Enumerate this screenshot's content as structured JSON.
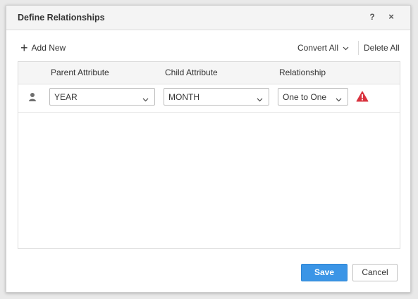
{
  "dialog": {
    "title": "Define Relationships",
    "help_glyph": "?",
    "close_glyph": "×"
  },
  "toolbar": {
    "add_new_label": "Add New",
    "convert_all_label": "Convert All",
    "delete_all_label": "Delete All"
  },
  "grid": {
    "columns": [
      "Parent Attribute",
      "Child Attribute",
      "Relationship"
    ],
    "rows": [
      {
        "icon": "user-icon",
        "parent": "YEAR",
        "child": "MONTH",
        "relationship": "One to One",
        "status_icon": "warning-icon",
        "status_color": "#d9333f"
      }
    ]
  },
  "footer": {
    "save_label": "Save",
    "cancel_label": "Cancel"
  },
  "colors": {
    "primary": "#3b95e6",
    "warning": "#d9333f"
  }
}
